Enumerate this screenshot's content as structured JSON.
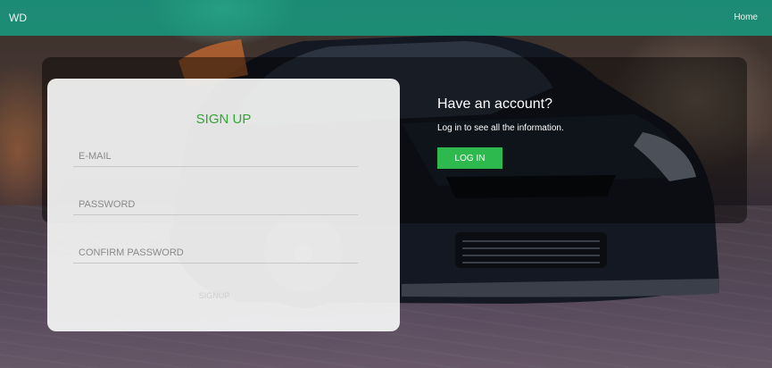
{
  "navbar": {
    "brand": "WD",
    "home_link": "Home",
    "color": "#16a085"
  },
  "login_panel": {
    "title": "Have an account?",
    "subtitle": "Log in to see all the information.",
    "login_button": "LOG IN",
    "button_color": "#2eb94e"
  },
  "signup_form": {
    "title": "SIGN UP",
    "title_color": "#33a532",
    "email_placeholder": "E-MAIL",
    "password_placeholder": "PASSWORD",
    "confirm_password_placeholder": "CONFIRM PASSWORD",
    "signup_button": "SIGNUP"
  },
  "background": {
    "subject": "dark sports car photo"
  }
}
